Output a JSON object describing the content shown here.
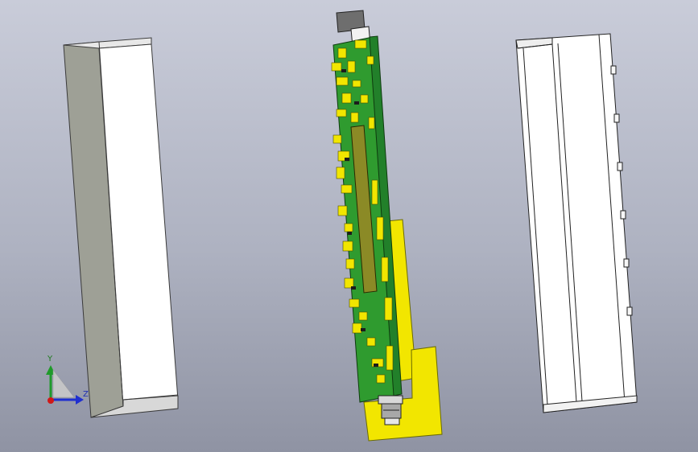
{
  "viewport": {
    "background_top": "#c9ccd9",
    "background_bottom": "#8f93a3"
  },
  "triad": {
    "y_label": "Y",
    "z_label": "Z",
    "colors": {
      "y": "#1f9a2a",
      "z": "#1f2fd0",
      "x": "#d01818"
    }
  },
  "parts": {
    "left_housing": {
      "icon": "enclosure-shell",
      "colors": {
        "face": "#ffffff",
        "side": "#9ea096"
      }
    },
    "pcb_assembly": {
      "icon": "circuit-board",
      "colors": {
        "board": "#2f9b2f",
        "component": "#f2e600",
        "connector": "#666666"
      }
    },
    "right_housing": {
      "icon": "enclosure-cover",
      "colors": {
        "face": "#ffffff",
        "edge": "#222222"
      }
    }
  }
}
